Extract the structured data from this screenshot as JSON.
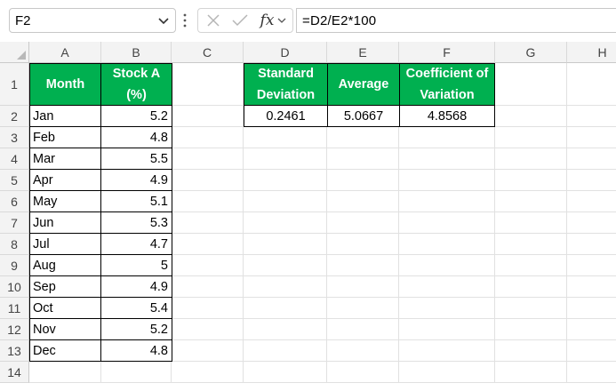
{
  "formula_bar": {
    "name_box": "F2",
    "fx_label": "fx",
    "formula": "=D2/E2*100"
  },
  "columns": [
    "A",
    "B",
    "C",
    "D",
    "E",
    "F",
    "G",
    "H"
  ],
  "rows": [
    "1",
    "2",
    "3",
    "4",
    "5",
    "6",
    "7",
    "8",
    "9",
    "10",
    "11",
    "12",
    "13",
    "14"
  ],
  "table1": {
    "header_month": "Month",
    "header_stock_line1": "Stock A",
    "header_stock_line2": "(%)",
    "months": [
      "Jan",
      "Feb",
      "Mar",
      "Apr",
      "May",
      "Jun",
      "Jul",
      "Aug",
      "Sep",
      "Oct",
      "Nov",
      "Dec"
    ],
    "values": [
      "5.2",
      "4.8",
      "5.5",
      "4.9",
      "5.1",
      "5.3",
      "4.7",
      "5",
      "4.9",
      "5.4",
      "5.2",
      "4.8"
    ]
  },
  "table2": {
    "h_std_line1": "Standard",
    "h_std_line2": "Deviation",
    "h_avg": "Average",
    "h_cv_line1": "Coefficient of",
    "h_cv_line2": "Variation",
    "std": "0.2461",
    "avg": "5.0667",
    "cv": "4.8568"
  },
  "colors": {
    "header_fill": "#00b050",
    "header_text": "#ffffff"
  }
}
